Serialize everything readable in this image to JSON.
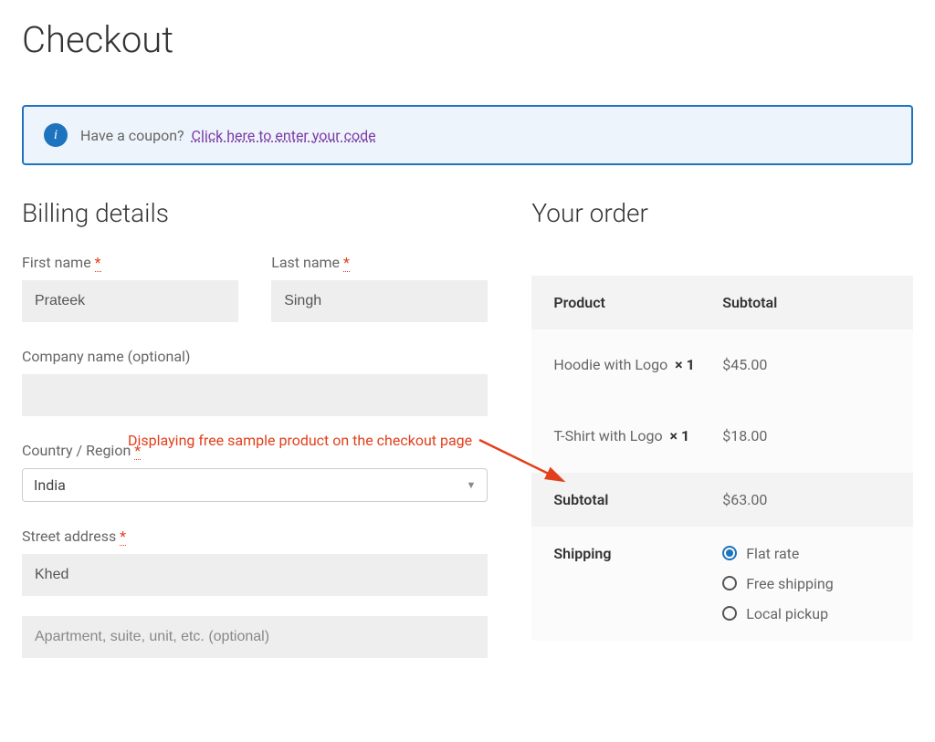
{
  "page_title": "Checkout",
  "coupon": {
    "prompt": "Have a coupon?",
    "link_text": "Click here to enter your code"
  },
  "billing": {
    "heading": "Billing details",
    "first_name_label": "First name",
    "first_name_value": "Prateek",
    "last_name_label": "Last name",
    "last_name_value": "Singh",
    "company_label": "Company name (optional)",
    "company_value": "",
    "country_label": "Country / Region",
    "country_value": "India",
    "street_label": "Street address",
    "street_value": "Khed",
    "street2_placeholder": "Apartment, suite, unit, etc. (optional)"
  },
  "order": {
    "heading": "Your order",
    "col_product": "Product",
    "col_subtotal": "Subtotal",
    "items": [
      {
        "name": "Hoodie with Logo",
        "qty": "× 1",
        "price": "$45.00"
      },
      {
        "name": "T-Shirt with Logo",
        "qty": "× 1",
        "price": "$18.00"
      }
    ],
    "subtotal_label": "Subtotal",
    "subtotal_value": "$63.00",
    "shipping_label": "Shipping",
    "shipping_options": [
      {
        "label": "Flat rate",
        "checked": true
      },
      {
        "label": "Free shipping",
        "checked": false
      },
      {
        "label": "Local pickup",
        "checked": false
      }
    ]
  },
  "annotation": {
    "text": "Displaying free sample product on the checkout page"
  },
  "required_marker": "*"
}
